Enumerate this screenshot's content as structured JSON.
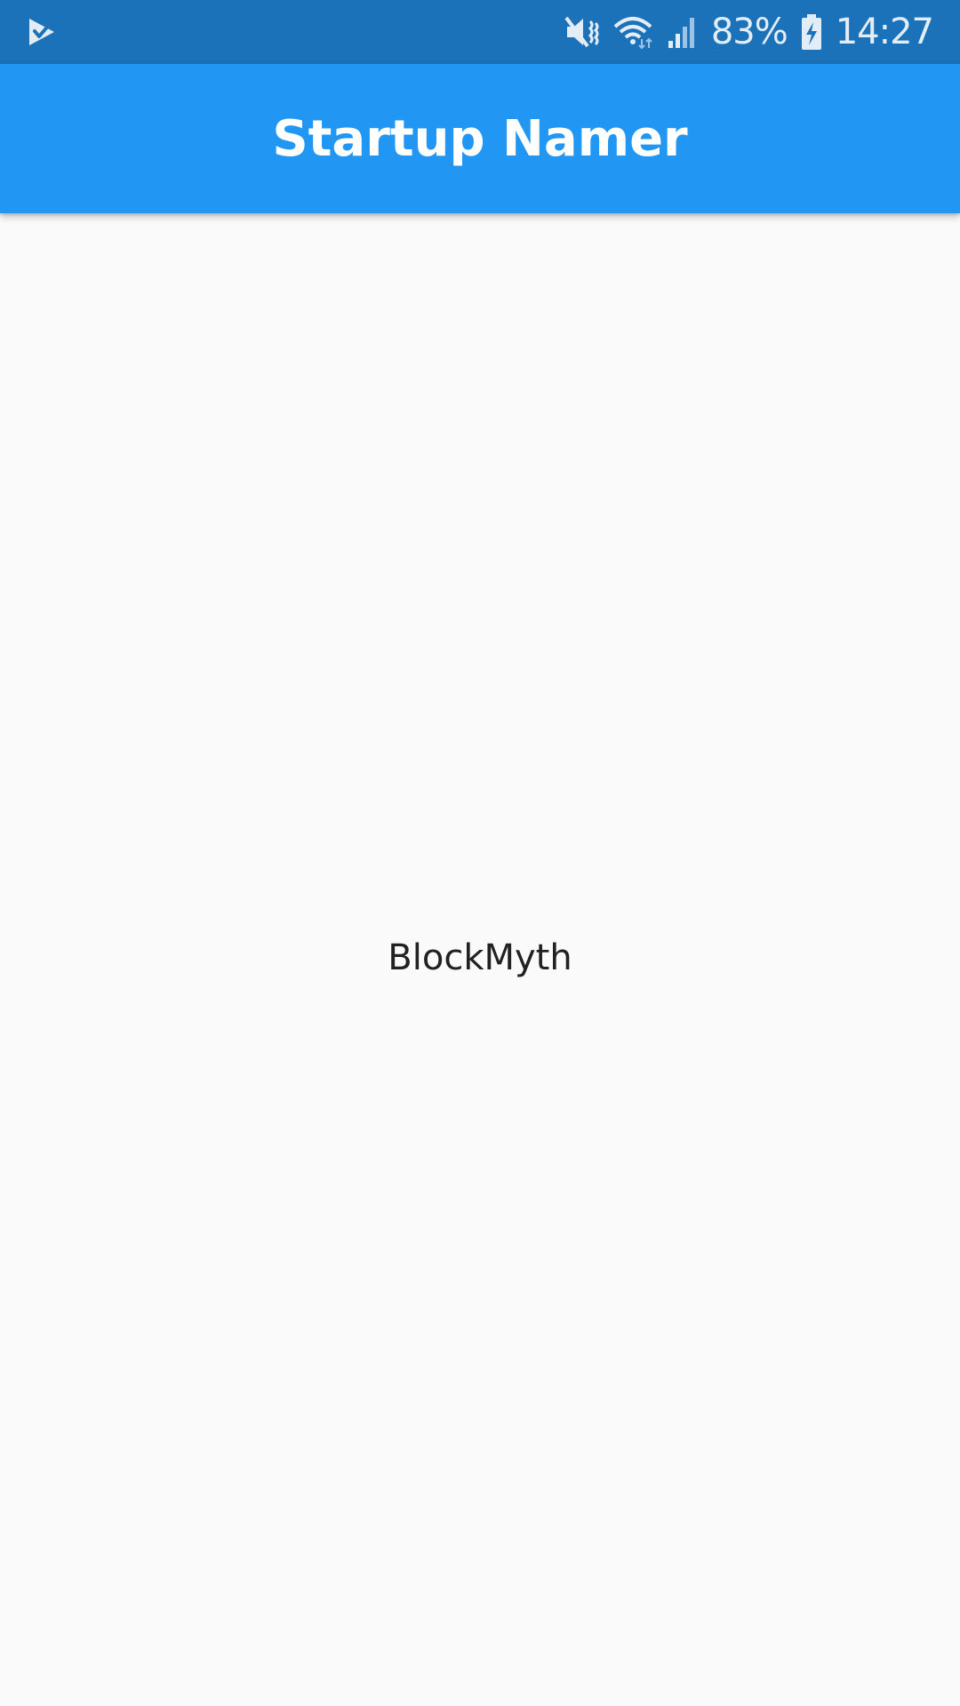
{
  "status_bar": {
    "battery_percent": "83%",
    "time": "14:27",
    "icons": [
      "app-notification-icon",
      "mute-icon",
      "wifi-icon",
      "signal-icon",
      "battery-charging-icon"
    ],
    "colors": {
      "background": "#1c72b8",
      "foreground": "#e3edf7"
    }
  },
  "app_bar": {
    "title": "Startup Namer",
    "color": "#2196f3"
  },
  "body": {
    "word": "BlockMyth",
    "background": "#fafafa"
  }
}
